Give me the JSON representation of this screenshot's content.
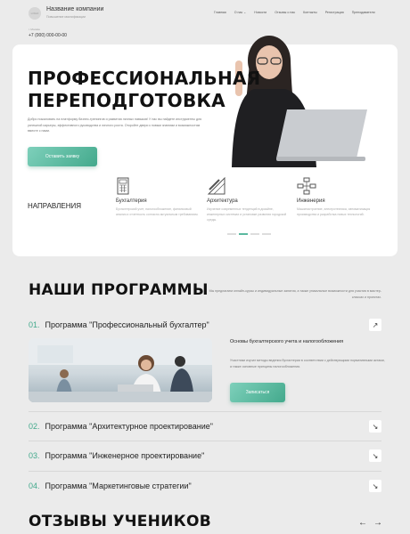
{
  "header": {
    "logo_text": "LOGO",
    "company_name": "Название компании",
    "company_sub": "Повышение квалификации",
    "city": "г. Москва",
    "phone": "+7 (000) 000-00-00",
    "nav": [
      "Главная",
      "О нас",
      "Новости",
      "Отзывы о нас",
      "Контакты",
      "Регистрация",
      "Преподаватели"
    ]
  },
  "hero": {
    "title_line1": "ПРОФЕССИОНАЛЬНАЯ",
    "title_line2": "ПЕРЕПОДГОТОВКА",
    "text": "Добро пожаловать на платформу бизнес-тренингов и развития личных навыков! У нас вы найдете инструменты для успешной карьеры, эффективного руководства и личного роста. Откройте двери к новым знаниям и возможностям вместе с нами.",
    "button": "Оставить заявку",
    "directions_label": "НАПРАВЛЕНИЯ",
    "directions": [
      {
        "title": "Бухгалтерия",
        "desc": "Бухгалтерский учет, налогообложение, финансовый анализ и отчетность согласно актуальным требованиям."
      },
      {
        "title": "Архитектура",
        "desc": "Изучение современных тенденций в дизайне, инженерных системах и установке развития городской среды."
      },
      {
        "title": "Инженерия",
        "desc": "Машиностроение, электротехника, автоматизация производства и разработка новых технологий."
      }
    ]
  },
  "programs": {
    "title": "НАШИ ПРОГРАММЫ",
    "desc": "Мы предлагаем онлайн-курсы и индивидуальные занятия, а также уникальные возможности для участия в мастер-классах и проектах.",
    "items": [
      {
        "num": "01.",
        "title": "Программа \"Профессиональный бухгалтер\"",
        "subtitle": "Основы бухгалтерского учета и налогообложения",
        "desc": "Участники изучат методы ведения бухгалтерии в соответствии с действующими нормативными актами, а также основные принципы налогообложения.",
        "button": "Записаться"
      },
      {
        "num": "02.",
        "title": "Программа \"Архитектурное проектирование\""
      },
      {
        "num": "03.",
        "title": "Программа \"Инженерное проектирование\""
      },
      {
        "num": "04.",
        "title": "Программа \"Маркетинговые стратегии\""
      }
    ]
  },
  "reviews": {
    "title": "ОТЗЫВЫ УЧЕНИКОВ"
  }
}
